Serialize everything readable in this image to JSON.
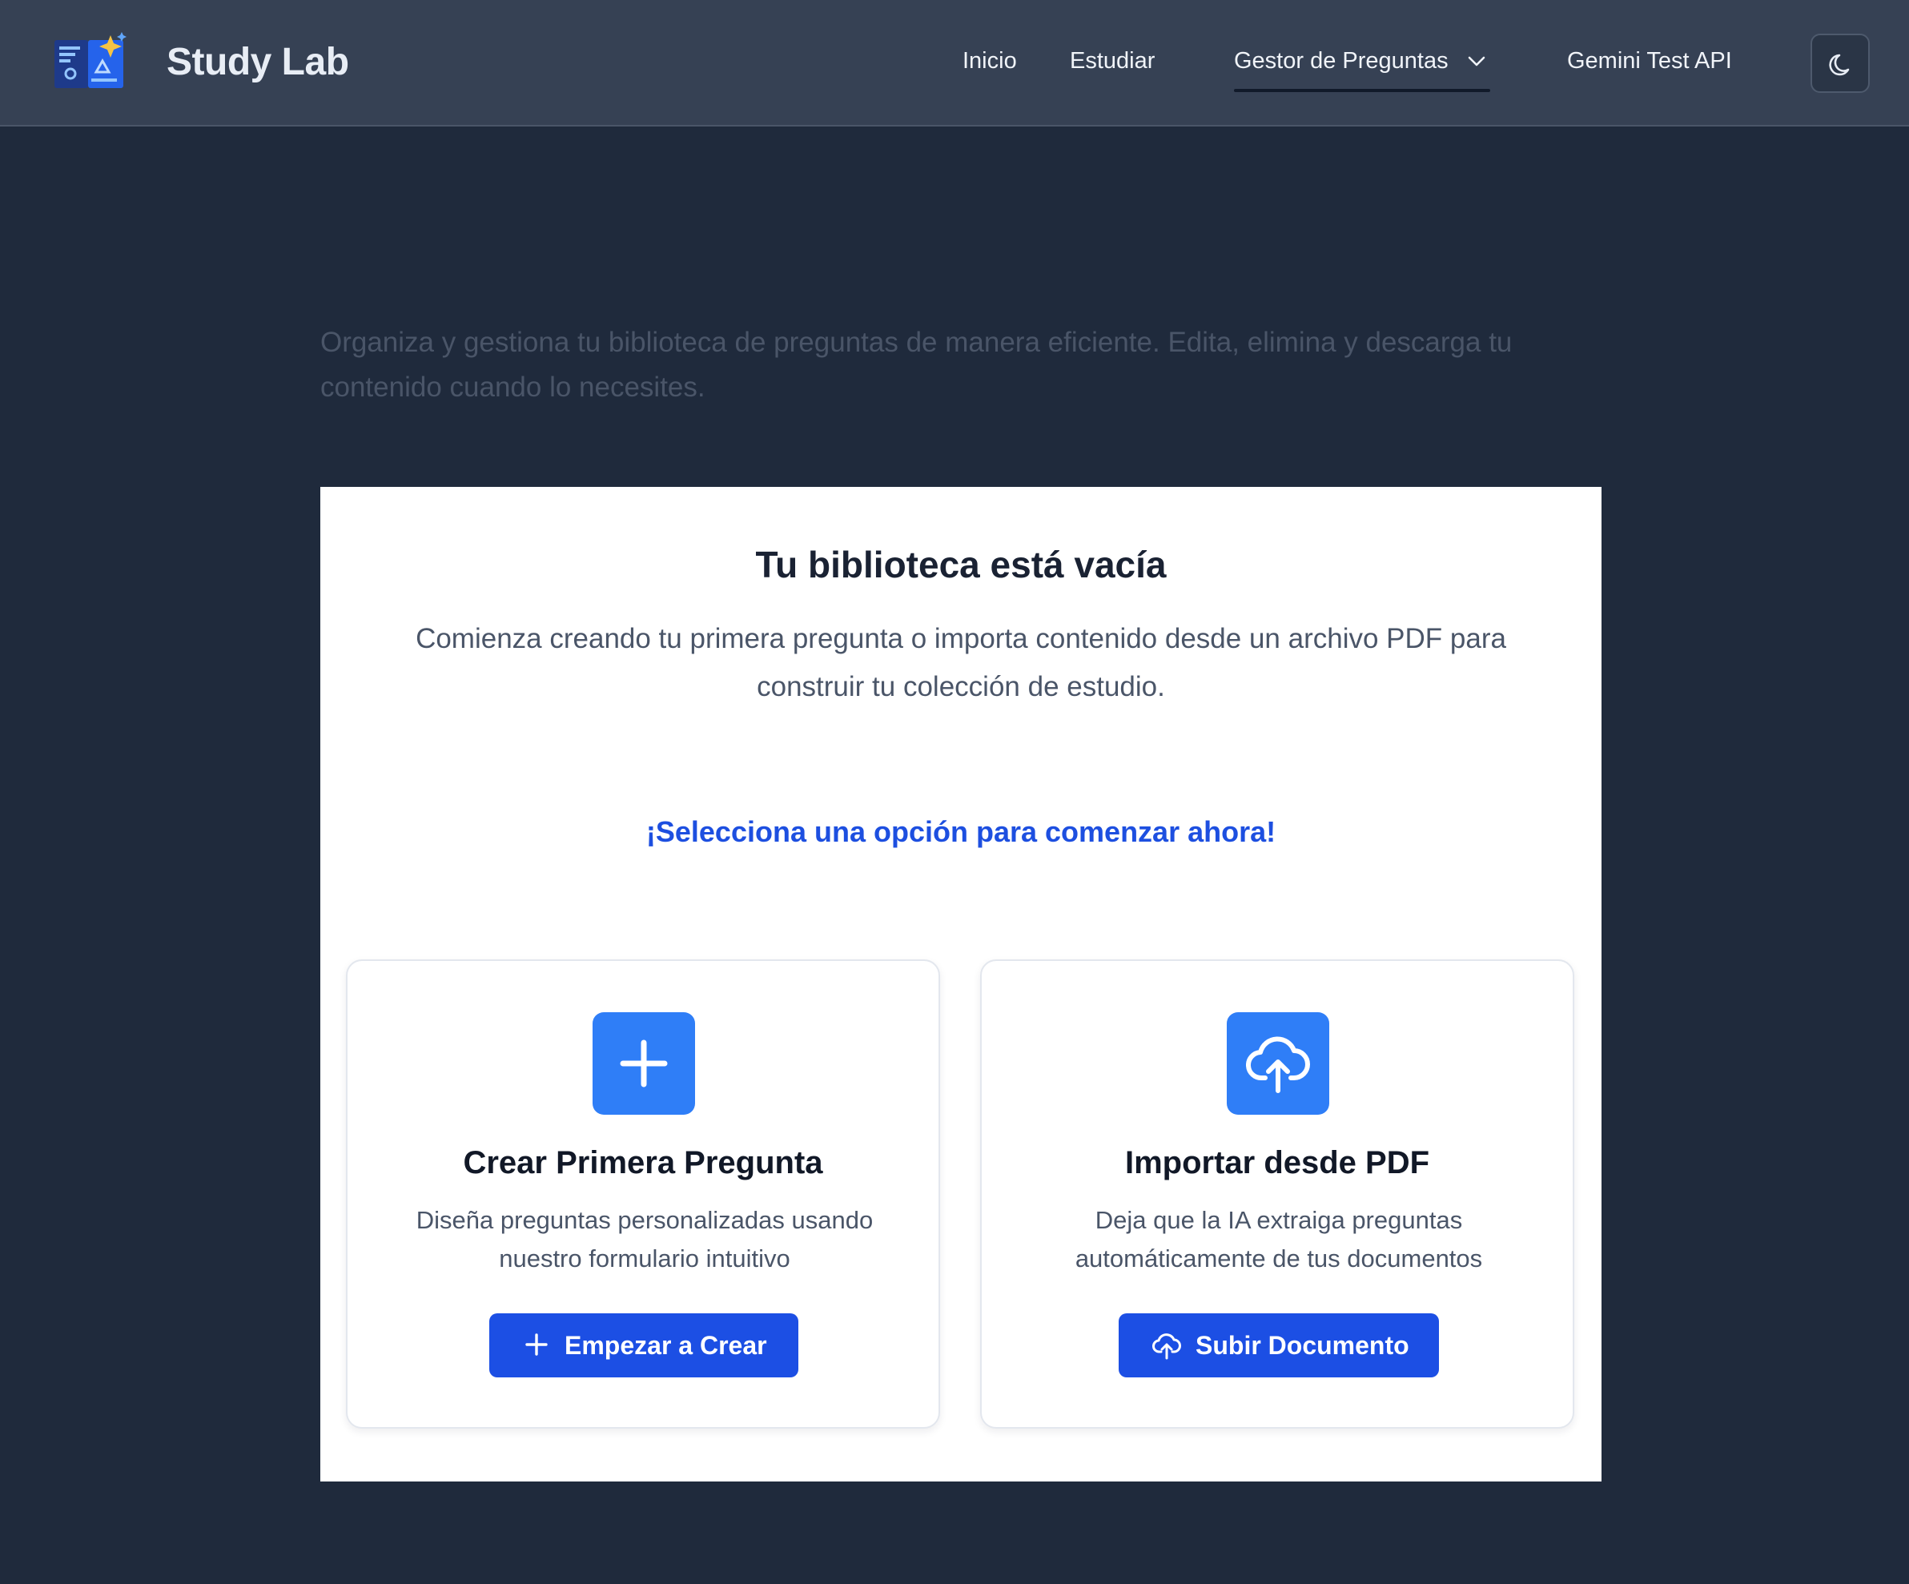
{
  "header": {
    "brand": "Study Lab",
    "nav": {
      "inicio": "Inicio",
      "estudiar": "Estudiar",
      "gestor": "Gestor de Preguntas",
      "gemini": "Gemini Test API"
    },
    "icons": {
      "logo": "book-sparkle-logo",
      "gestor_dropdown": "chevron-down-icon",
      "theme_toggle": "moon-icon"
    }
  },
  "main": {
    "subtitle": "Organiza y gestiona tu biblioteca de preguntas de manera eficiente. Edita, elimina y descarga tu contenido cuando lo necesites.",
    "empty_state": {
      "title": "Tu biblioteca está vacía",
      "description": "Comienza creando tu primera pregunta o importa contenido desde un archivo PDF para construir tu colección de estudio.",
      "cta": "¡Selecciona una opción para comenzar ahora!"
    },
    "cards": {
      "create": {
        "icon": "plus-icon",
        "title": "Crear Primera Pregunta",
        "description": "Diseña preguntas personalizadas usando nuestro formulario intuitivo",
        "button": "Empezar a Crear"
      },
      "import": {
        "icon": "cloud-upload-icon",
        "title": "Importar desde PDF",
        "description": "Deja que la IA extraiga preguntas automáticamente de tus documentos",
        "button": "Subir Documento"
      }
    }
  },
  "colors": {
    "page_bg": "#1f2a3c",
    "header_bg": "#364154",
    "accent": "#1c4fe4",
    "icon_tile": "#2f7ef7",
    "cta_text": "#1d4fe0"
  }
}
